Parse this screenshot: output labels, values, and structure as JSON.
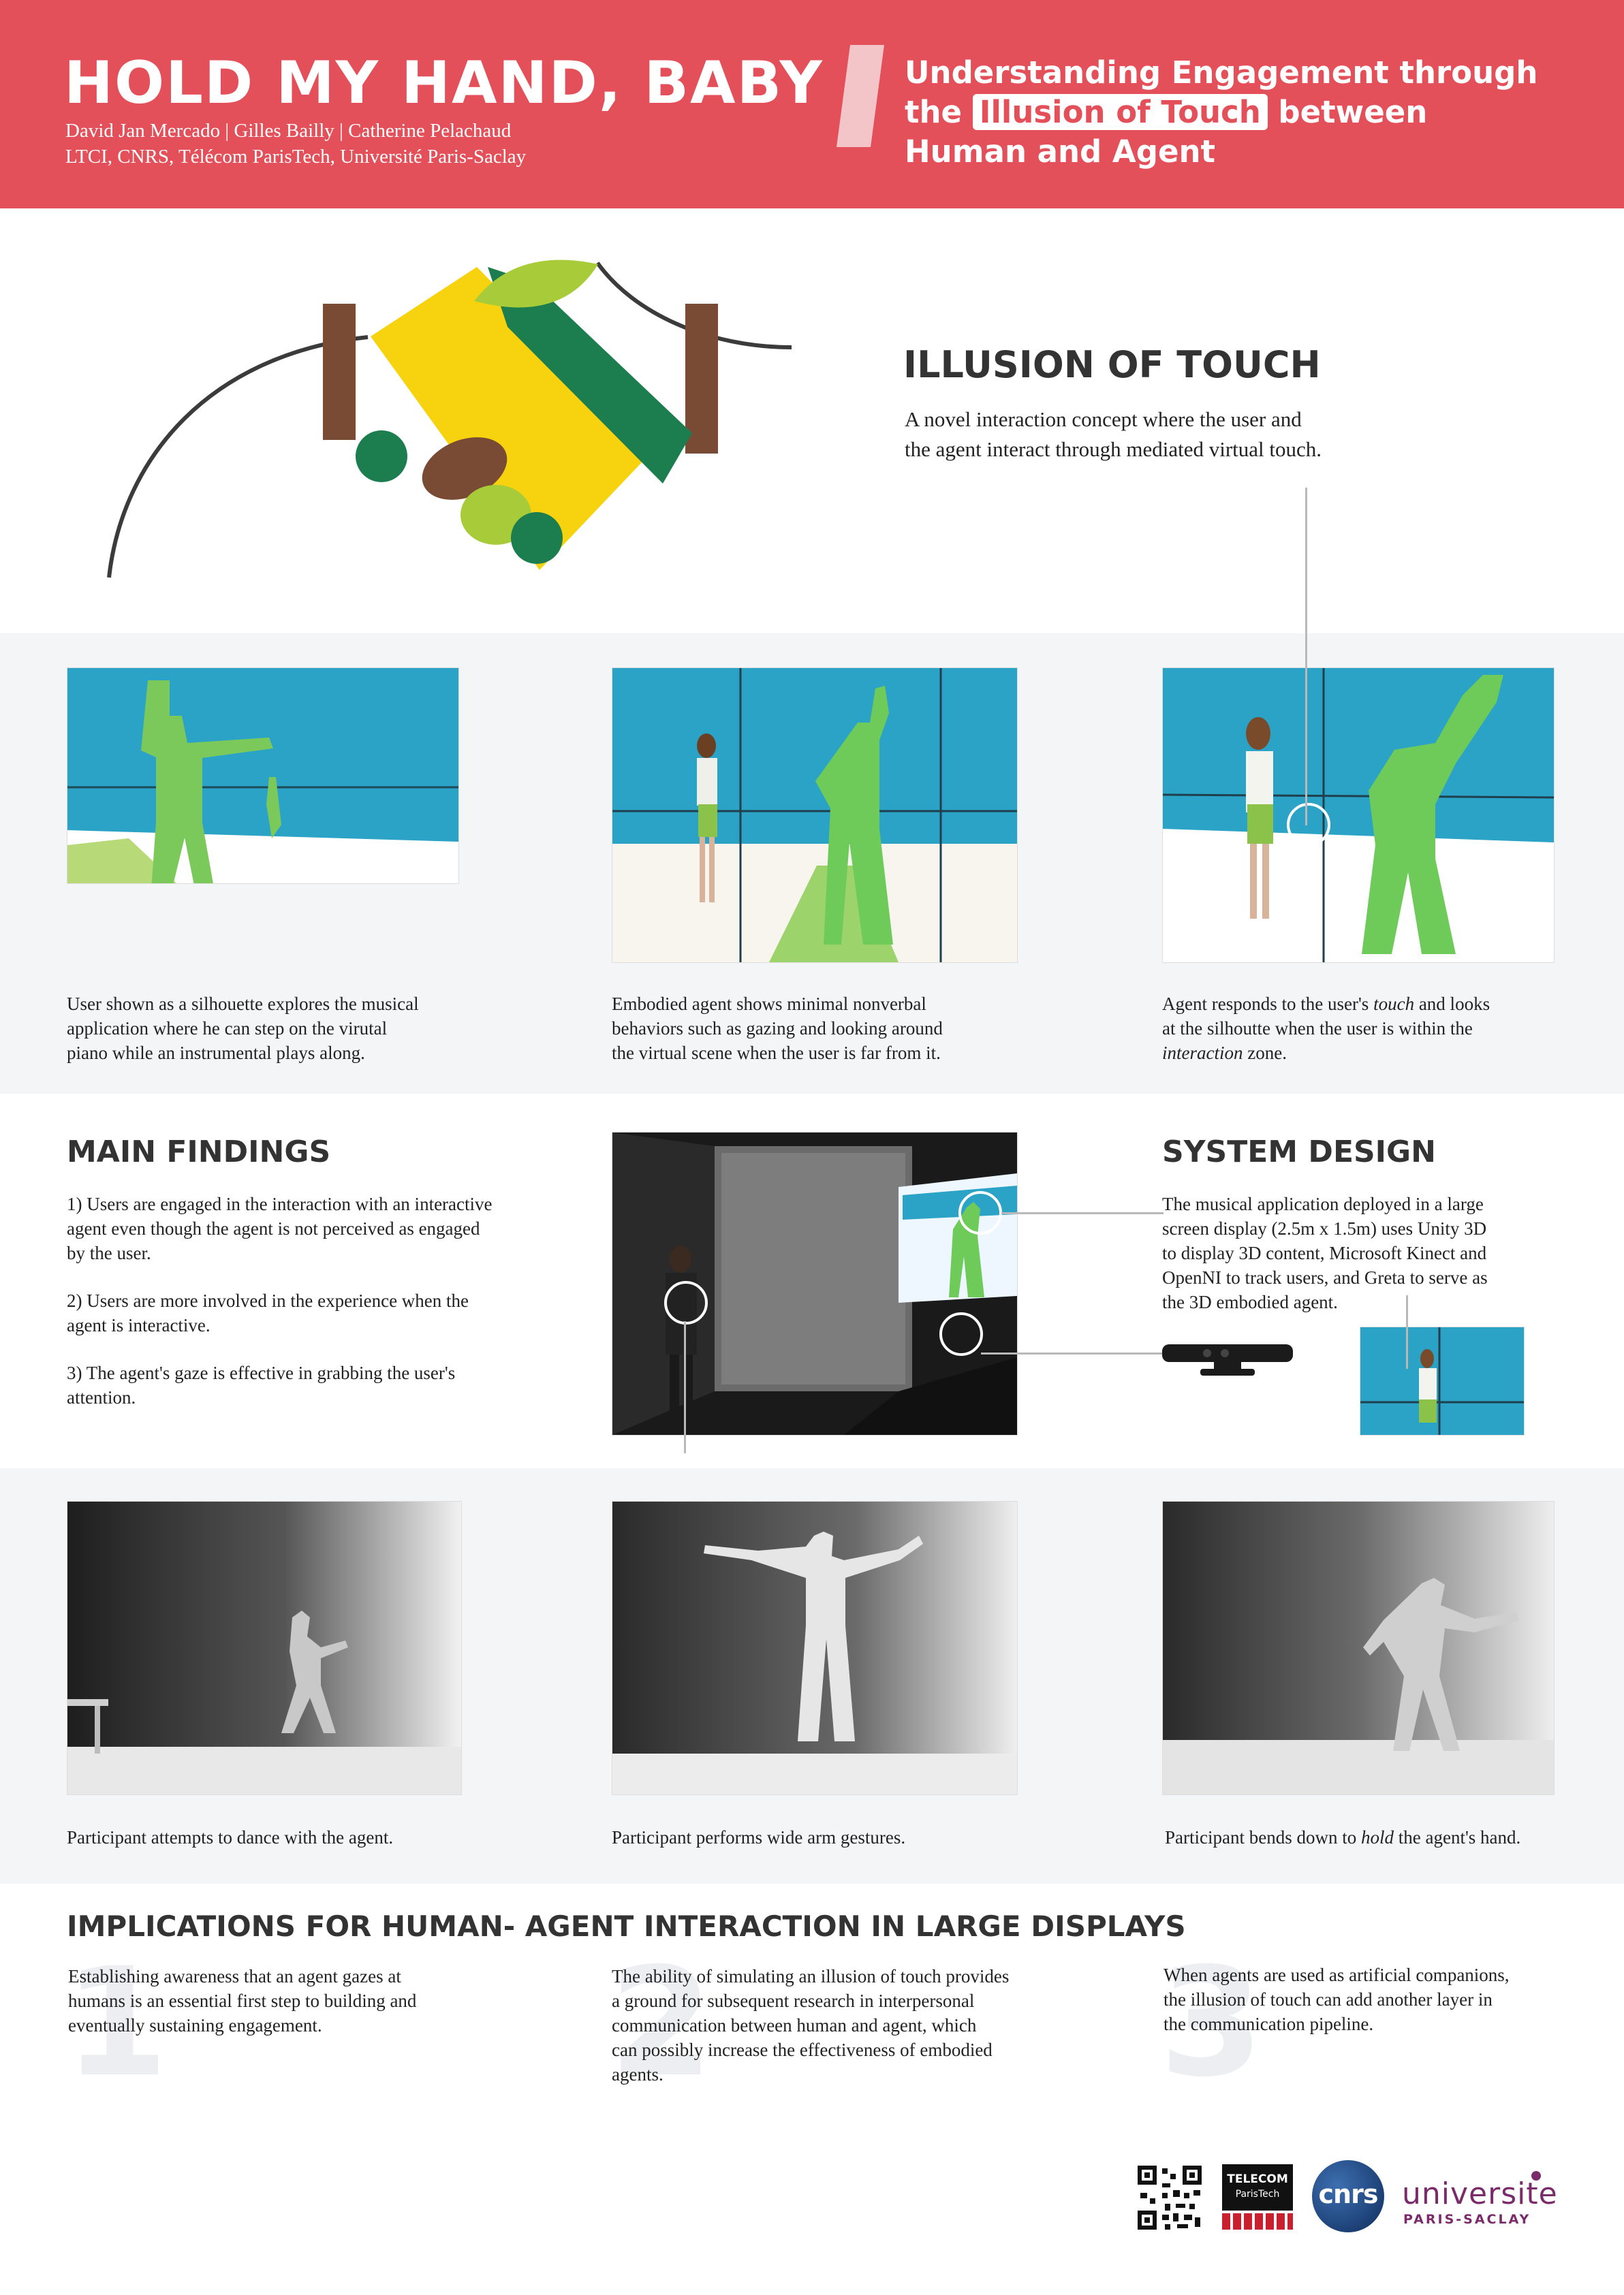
{
  "header": {
    "title": "HOLD MY HAND, BABY",
    "authors": "David Jan Mercado  |  Gilles Bailly  |  Catherine Pelachaud",
    "affiliation": "LTCI, CNRS, Télécom ParisTech, Université Paris-Saclay",
    "subtitle_line1": "Understanding Engagement through",
    "subtitle_line2_pre": "the",
    "subtitle_line2_highlight": "Illusion of Touch",
    "subtitle_line2_post": "between",
    "subtitle_line3": "Human and Agent"
  },
  "illusion": {
    "heading": "ILLUSION OF TOUCH",
    "text_line1": "A novel interaction concept where the user and",
    "text_line2": "the agent interact through mediated virtual touch."
  },
  "screens": [
    {
      "caption": [
        "User shown as a silhouette explores the musical",
        "application where he can step on the virutal",
        "piano while an instrumental plays along."
      ]
    },
    {
      "caption": [
        "Embodied agent shows minimal nonverbal",
        "behaviors such as gazing and looking around",
        "the virtual scene when the user is far from it."
      ]
    },
    {
      "caption_a": "Agent responds to the user's ",
      "caption_a_em": "touch",
      "caption_b": " and looks",
      "caption_line2": "at the silhoutte when the user is within the",
      "caption_line3_em": "interaction",
      "caption_line3": " zone."
    }
  ],
  "findings": {
    "heading": "MAIN FINDINGS",
    "items": [
      [
        "1) Users are engaged in the interaction with an interactive",
        "agent even though the agent is not perceived as engaged",
        "by the user."
      ],
      [
        "2) Users are more involved in the experience when the",
        "agent is interactive."
      ],
      [
        "3) The agent's gaze is effective in grabbing the user's",
        "attention."
      ]
    ]
  },
  "system": {
    "heading": "SYSTEM DESIGN",
    "lines": [
      "The musical application deployed in a large",
      "screen display (2.5m x 1.5m) uses Unity 3D",
      "to display 3D content, Microsoft Kinect and",
      "OpenNI to track users, and Greta to serve as",
      "the 3D embodied agent."
    ]
  },
  "depth": [
    {
      "caption": "Participant attempts to dance with the agent."
    },
    {
      "caption": "Participant performs wide arm gestures."
    },
    {
      "caption_pre": "Participant bends down to ",
      "caption_em": "hold",
      "caption_post": " the agent's hand."
    }
  ],
  "implications": {
    "heading": "IMPLICATIONS FOR HUMAN- AGENT INTERACTION IN LARGE DISPLAYS",
    "items": [
      {
        "num": "1",
        "lines": [
          "Establishing awareness that an agent gazes at",
          "humans is an essential first step to building and",
          "eventually sustaining engagement."
        ]
      },
      {
        "num": "2",
        "lines": [
          "The ability of simulating an illusion of touch provides",
          "a ground for subsequent research in interpersonal",
          "communication between human and agent, which",
          "can possibly increase the effectiveness of embodied",
          "agents."
        ]
      },
      {
        "num": "3",
        "lines": [
          "When agents are used as artificial companions,",
          "the illusion of touch can add another layer in",
          "the communication pipeline."
        ]
      }
    ]
  },
  "logos": {
    "telecom_line1": "TELECOM",
    "telecom_line2": "ParisTech",
    "cnrs": "cnrs",
    "univ_line1": "universite",
    "univ_line2": "PARIS-SACLAY"
  },
  "colors": {
    "brand_red": "#e4505a",
    "screen_blue": "#2aa3c6",
    "silhouette_green": "#7bc95a"
  }
}
